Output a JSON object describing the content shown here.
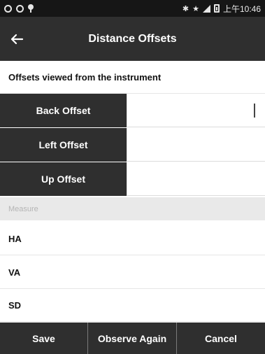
{
  "status_bar": {
    "right_text": "上午10:46"
  },
  "app_bar": {
    "title": "Distance Offsets",
    "back_icon": "back-arrow-icon"
  },
  "info": {
    "text": "Offsets viewed from the instrument"
  },
  "offsets": [
    {
      "label": "Back Offset",
      "value": ""
    },
    {
      "label": "Left Offset",
      "value": ""
    },
    {
      "label": "Up Offset",
      "value": ""
    }
  ],
  "section": {
    "header": "Measure"
  },
  "measure_rows": [
    {
      "label": "HA",
      "value": ""
    },
    {
      "label": "VA",
      "value": ""
    },
    {
      "label": "SD",
      "value": ""
    }
  ],
  "bottom": {
    "save": "Save",
    "observe_again": "Observe Again",
    "cancel": "Cancel"
  },
  "colors": {
    "dark": "#2f2f2f",
    "status": "#161616",
    "section_bg": "#e9e9e9"
  }
}
